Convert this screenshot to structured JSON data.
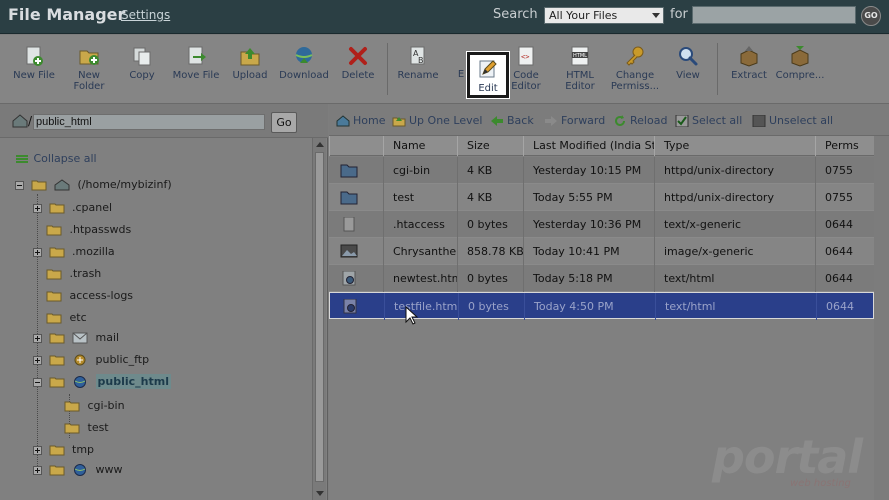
{
  "header": {
    "title": "File Manager",
    "settings_link": "Settings",
    "search_label": "Search",
    "search_scope": "All Your Files",
    "for_label": "for",
    "search_value": "",
    "go_label": "GO"
  },
  "toolbar": {
    "buttons": [
      {
        "label": "New File",
        "icon": "new-file-icon"
      },
      {
        "label": "New Folder",
        "icon": "new-folder-icon"
      },
      {
        "label": "Copy",
        "icon": "copy-icon"
      },
      {
        "label": "Move File",
        "icon": "move-file-icon"
      },
      {
        "label": "Upload",
        "icon": "upload-icon"
      },
      {
        "label": "Download",
        "icon": "download-icon"
      },
      {
        "label": "Delete",
        "icon": "delete-icon"
      },
      {
        "label": "Rename",
        "icon": "rename-icon"
      },
      {
        "label": "Edit",
        "icon": "edit-icon"
      },
      {
        "label": "Code Editor",
        "icon": "code-editor-icon"
      },
      {
        "label": "HTML Editor",
        "icon": "html-editor-icon"
      },
      {
        "label": "Change Permiss...",
        "icon": "permissions-icon"
      },
      {
        "label": "View",
        "icon": "view-icon"
      },
      {
        "label": "Extract",
        "icon": "extract-icon"
      },
      {
        "label": "Compre...",
        "icon": "compress-icon"
      }
    ],
    "partial_e_label": "E"
  },
  "left": {
    "path_value": "public_html",
    "go_label": "Go",
    "collapse_all": "Collapse all",
    "tree": [
      {
        "label": "(/home/mybizinf)"
      },
      {
        "label": ".cpanel"
      },
      {
        "label": ".htpasswds"
      },
      {
        "label": ".mozilla"
      },
      {
        "label": ".trash"
      },
      {
        "label": "access-logs"
      },
      {
        "label": "etc"
      },
      {
        "label": "mail"
      },
      {
        "label": "public_ftp"
      },
      {
        "label": "public_html"
      },
      {
        "label": "cgi-bin"
      },
      {
        "label": "test"
      },
      {
        "label": "tmp"
      },
      {
        "label": "www"
      }
    ]
  },
  "nav": {
    "home": "Home",
    "up_one_level": "Up One Level",
    "back": "Back",
    "forward": "Forward",
    "reload": "Reload",
    "select_all": "Select all",
    "unselect_all": "Unselect all"
  },
  "table": {
    "headers": [
      "Name",
      "Size",
      "Last Modified (India Standard Time)",
      "Type",
      "Perms"
    ],
    "rows": [
      {
        "name": "cgi-bin",
        "size": "4 KB",
        "modified": "Yesterday 10:15 PM",
        "type": "httpd/unix-directory",
        "perms": "0755",
        "icon": "folder-icon"
      },
      {
        "name": "test",
        "size": "4 KB",
        "modified": "Today 5:55 PM",
        "type": "httpd/unix-directory",
        "perms": "0755",
        "icon": "folder-icon"
      },
      {
        "name": ".htaccess",
        "size": "0 bytes",
        "modified": "Yesterday 10:36 PM",
        "type": "text/x-generic",
        "perms": "0644",
        "icon": "text-file-icon"
      },
      {
        "name": "Chrysanthemum.jpg",
        "size": "858.78 KB",
        "modified": "Today 10:41 PM",
        "type": "image/x-generic",
        "perms": "0644",
        "icon": "image-file-icon"
      },
      {
        "name": "newtest.html",
        "size": "0 bytes",
        "modified": "Today 5:18 PM",
        "type": "text/html",
        "perms": "0644",
        "icon": "html-file-icon"
      },
      {
        "name": "testfile.html",
        "size": "0 bytes",
        "modified": "Today 4:50 PM",
        "type": "text/html",
        "perms": "0644",
        "icon": "html-file-icon"
      }
    ]
  },
  "watermark": {
    "brand": "portal",
    "tagline": "web hosting"
  },
  "colors": {
    "topbar": "#2b3f44",
    "selected_row": "#2a3f8a",
    "link": "#2e3f5c"
  }
}
